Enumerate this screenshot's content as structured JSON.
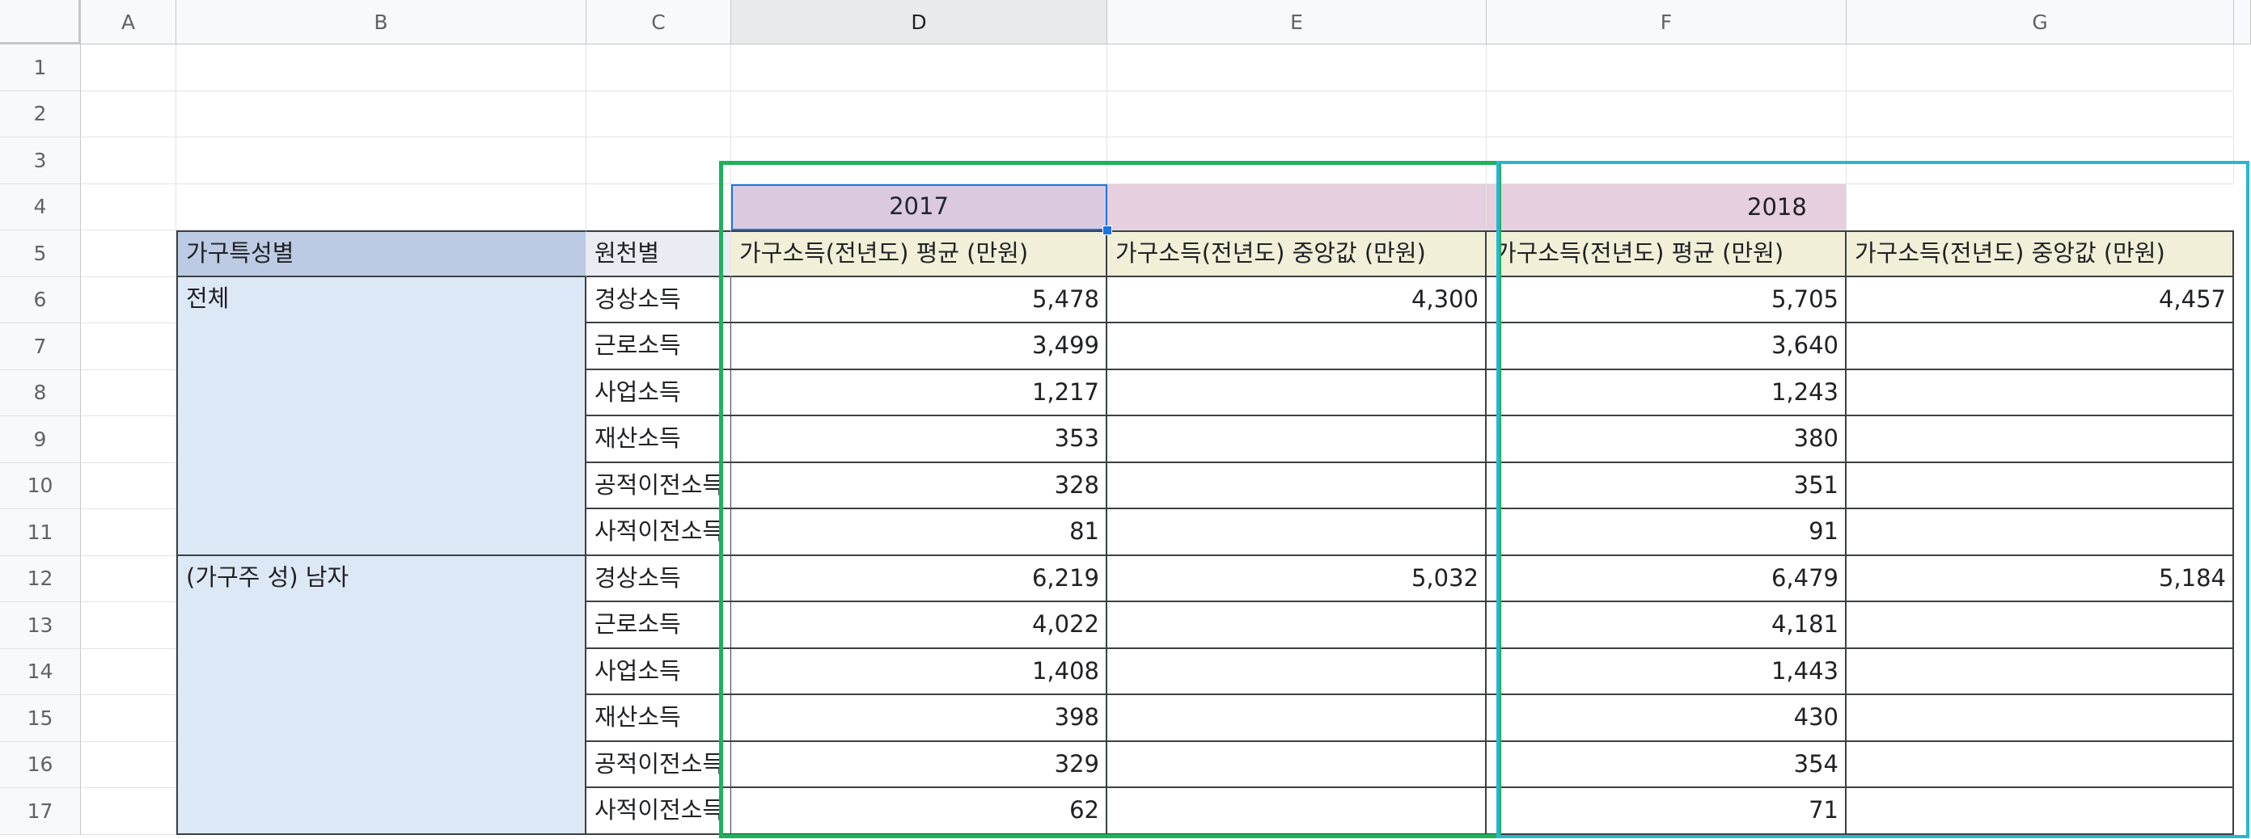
{
  "column_headers": [
    "A",
    "B",
    "C",
    "D",
    "E",
    "F",
    "G"
  ],
  "row_headers": [
    "1",
    "2",
    "3",
    "4",
    "5",
    "6",
    "7",
    "8",
    "9",
    "10",
    "11",
    "12",
    "13",
    "14",
    "15",
    "16",
    "17"
  ],
  "year_row": {
    "y2017": "2017",
    "y2018": "2018"
  },
  "header_row": {
    "group_label": "가구특성별",
    "source_label": "원천별",
    "d": "가구소득(전년도) 평균 (만원)",
    "e": "가구소득(전년도) 중앙값 (만원)",
    "f": "가구소득(전년도) 평균 (만원)",
    "g": "가구소득(전년도) 중앙값 (만원)"
  },
  "groups": [
    {
      "label": "전체"
    },
    {
      "label": "(가구주 성) 남자"
    }
  ],
  "rows": [
    {
      "source": "경상소득",
      "d": "5,478",
      "e": "4,300",
      "f": "5,705",
      "g": "4,457"
    },
    {
      "source": "근로소득",
      "d": "3,499",
      "e": "",
      "f": "3,640",
      "g": ""
    },
    {
      "source": "사업소득",
      "d": "1,217",
      "e": "",
      "f": "1,243",
      "g": ""
    },
    {
      "source": "재산소득",
      "d": "353",
      "e": "",
      "f": "380",
      "g": ""
    },
    {
      "source": "공적이전소득",
      "d": "328",
      "e": "",
      "f": "351",
      "g": ""
    },
    {
      "source": "사적이전소득",
      "d": "81",
      "e": "",
      "f": "91",
      "g": ""
    },
    {
      "source": "경상소득",
      "d": "6,219",
      "e": "5,032",
      "f": "6,479",
      "g": "5,184"
    },
    {
      "source": "근로소득",
      "d": "4,022",
      "e": "",
      "f": "4,181",
      "g": ""
    },
    {
      "source": "사업소득",
      "d": "1,408",
      "e": "",
      "f": "1,443",
      "g": ""
    },
    {
      "source": "재산소득",
      "d": "398",
      "e": "",
      "f": "430",
      "g": ""
    },
    {
      "source": "공적이전소득",
      "d": "329",
      "e": "",
      "f": "354",
      "g": ""
    },
    {
      "source": "사적이전소득",
      "d": "62",
      "e": "",
      "f": "71",
      "g": ""
    }
  ],
  "colors": {
    "year_fill": "#e6cfdf",
    "header_fill": "#f1efd8",
    "group_header_fill": "#bccbe3",
    "group_fill": "#dde8f6",
    "highlight_2017": "#1db25c",
    "highlight_2018": "#29b6d4",
    "selection": "#1a73e8"
  },
  "selected_cell": "D4"
}
